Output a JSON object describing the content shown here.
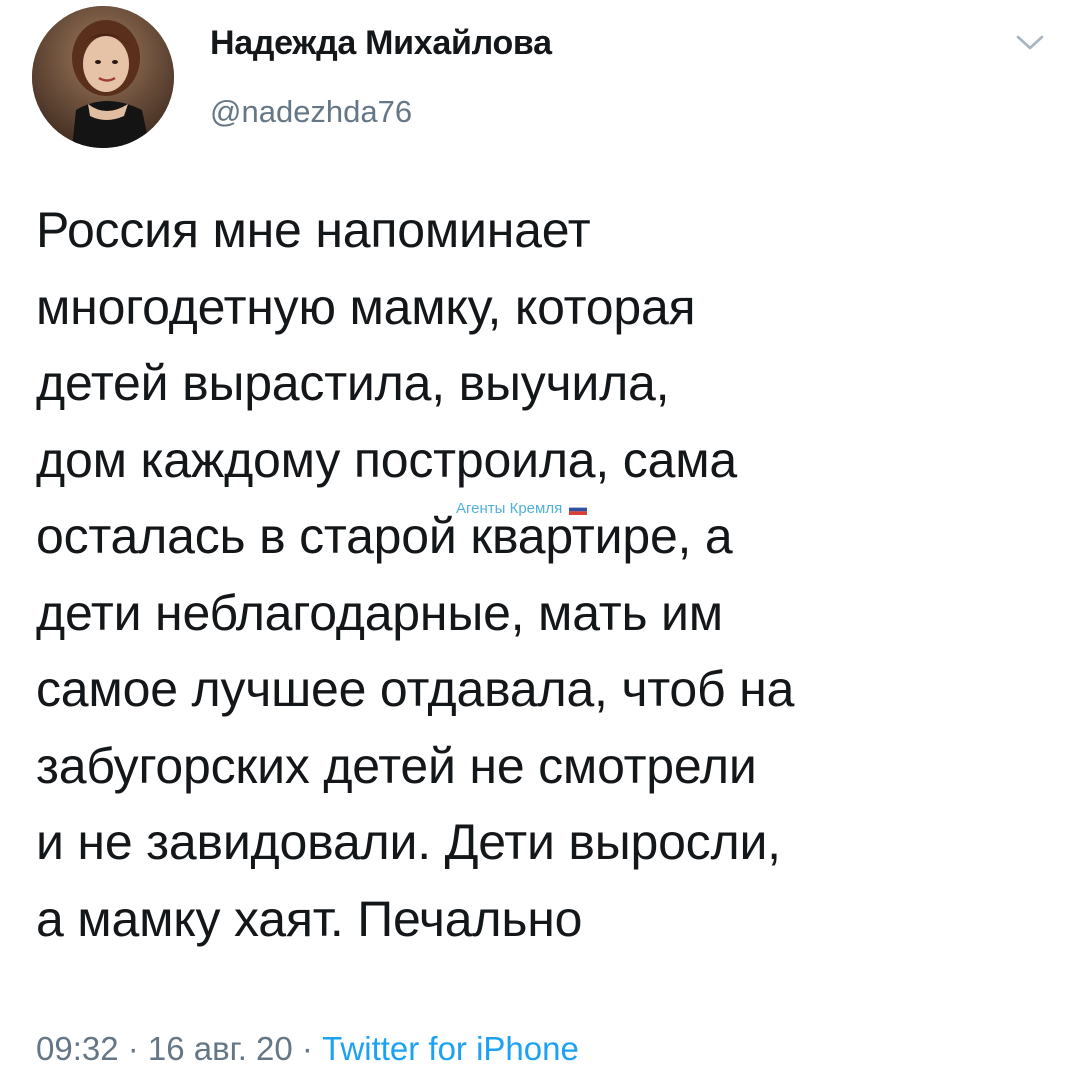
{
  "author": {
    "display_name": "Надежда Михайлова",
    "handle": "@nadezhda76",
    "avatar_icon": "profile-photo",
    "menu_icon": "chevron-down-icon"
  },
  "tweet": {
    "lines": [
      "Россия мне напоминает",
      "многодетную мамку, которая",
      "детей вырастила, выучила,",
      "дом каждому построила, сама",
      "осталась в старой квартире, а",
      "дети неблагодарные, мать им",
      "самое лучшее отдавала, чтоб на",
      "забугорских детей не смотрели",
      "и не завидовали. Дети выросли,",
      "а мамку хаят. Печально"
    ]
  },
  "watermark": {
    "text": "Агенты Кремля",
    "icon": "russian-flag-icon"
  },
  "meta": {
    "time": "09:32",
    "separator": " · ",
    "date": "16 авг. 20",
    "source": "Twitter for iPhone"
  },
  "colors": {
    "text": "#14171a",
    "secondary": "#657786",
    "link": "#1da1f2",
    "watermark": "#3fa8d8"
  }
}
